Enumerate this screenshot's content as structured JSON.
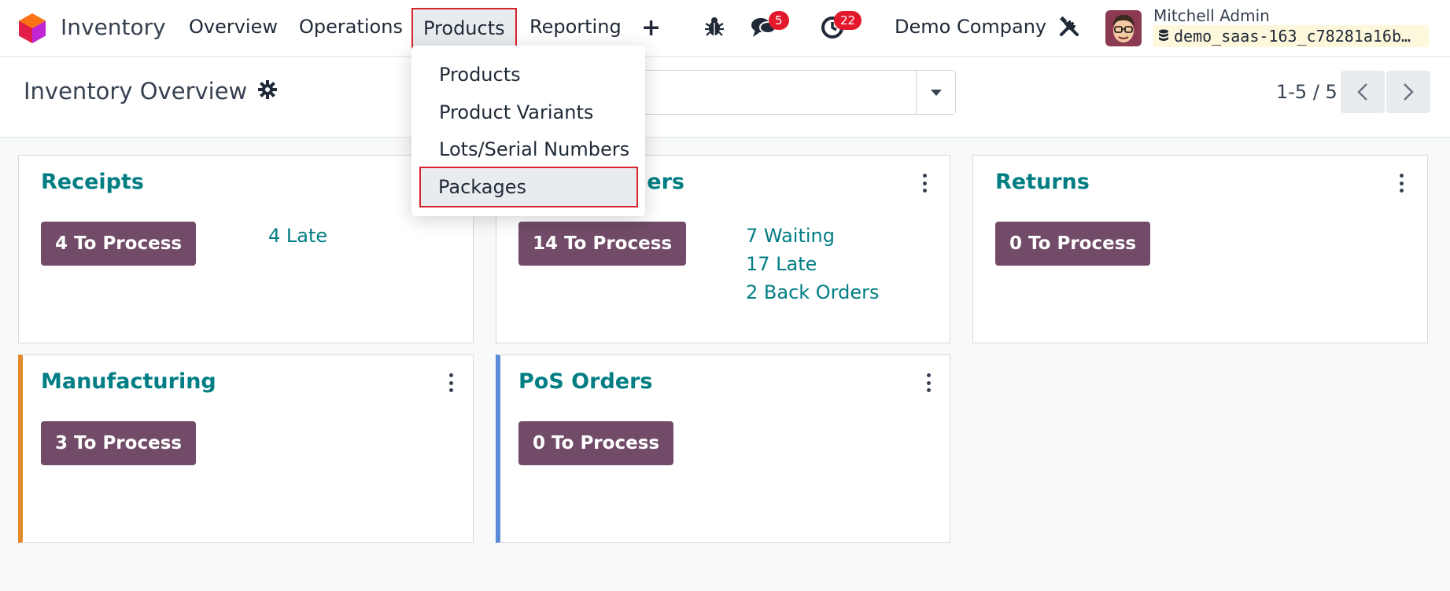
{
  "app": {
    "name": "Inventory"
  },
  "nav": {
    "menu": [
      "Overview",
      "Operations",
      "Products",
      "Reporting"
    ],
    "active": "Products",
    "messages_count": "5",
    "activities_count": "22",
    "company": "Demo Company",
    "user_name": "Mitchell Admin",
    "database": "demo_saas-163_c78281a16b…"
  },
  "control_panel": {
    "title": "Inventory Overview",
    "pager": "1-5 / 5"
  },
  "products_menu": {
    "items": [
      "Products",
      "Product Variants",
      "Lots/Serial Numbers",
      "Packages"
    ],
    "highlighted": "Packages"
  },
  "cards": [
    {
      "title": "Receipts",
      "button": "4 To Process",
      "stats": [
        "4 Late"
      ]
    },
    {
      "title": "Delivery Orders",
      "visible_title_fragment": "lers",
      "button": "14 To Process",
      "stats": [
        "7 Waiting",
        "17 Late",
        "2 Back Orders"
      ]
    },
    {
      "title": "Returns",
      "button": "0 To Process",
      "stats": []
    },
    {
      "title": "Manufacturing",
      "button": "3 To Process",
      "stats": [],
      "accent": "#e68a2e"
    },
    {
      "title": "PoS Orders",
      "button": "0 To Process",
      "stats": [],
      "accent": "#5b8bd6"
    }
  ],
  "colors": {
    "primary": "#714b67",
    "link": "#017e84",
    "highlight_outline": "#d9232e",
    "badge": "#e3192b"
  },
  "icons": [
    "app-logo-icon",
    "debug-icon",
    "chat-icon",
    "clock-icon",
    "tools-icon",
    "gear-icon",
    "caret-down-icon",
    "chevron-left-icon",
    "chevron-right-icon",
    "database-icon",
    "kebab-icon"
  ]
}
